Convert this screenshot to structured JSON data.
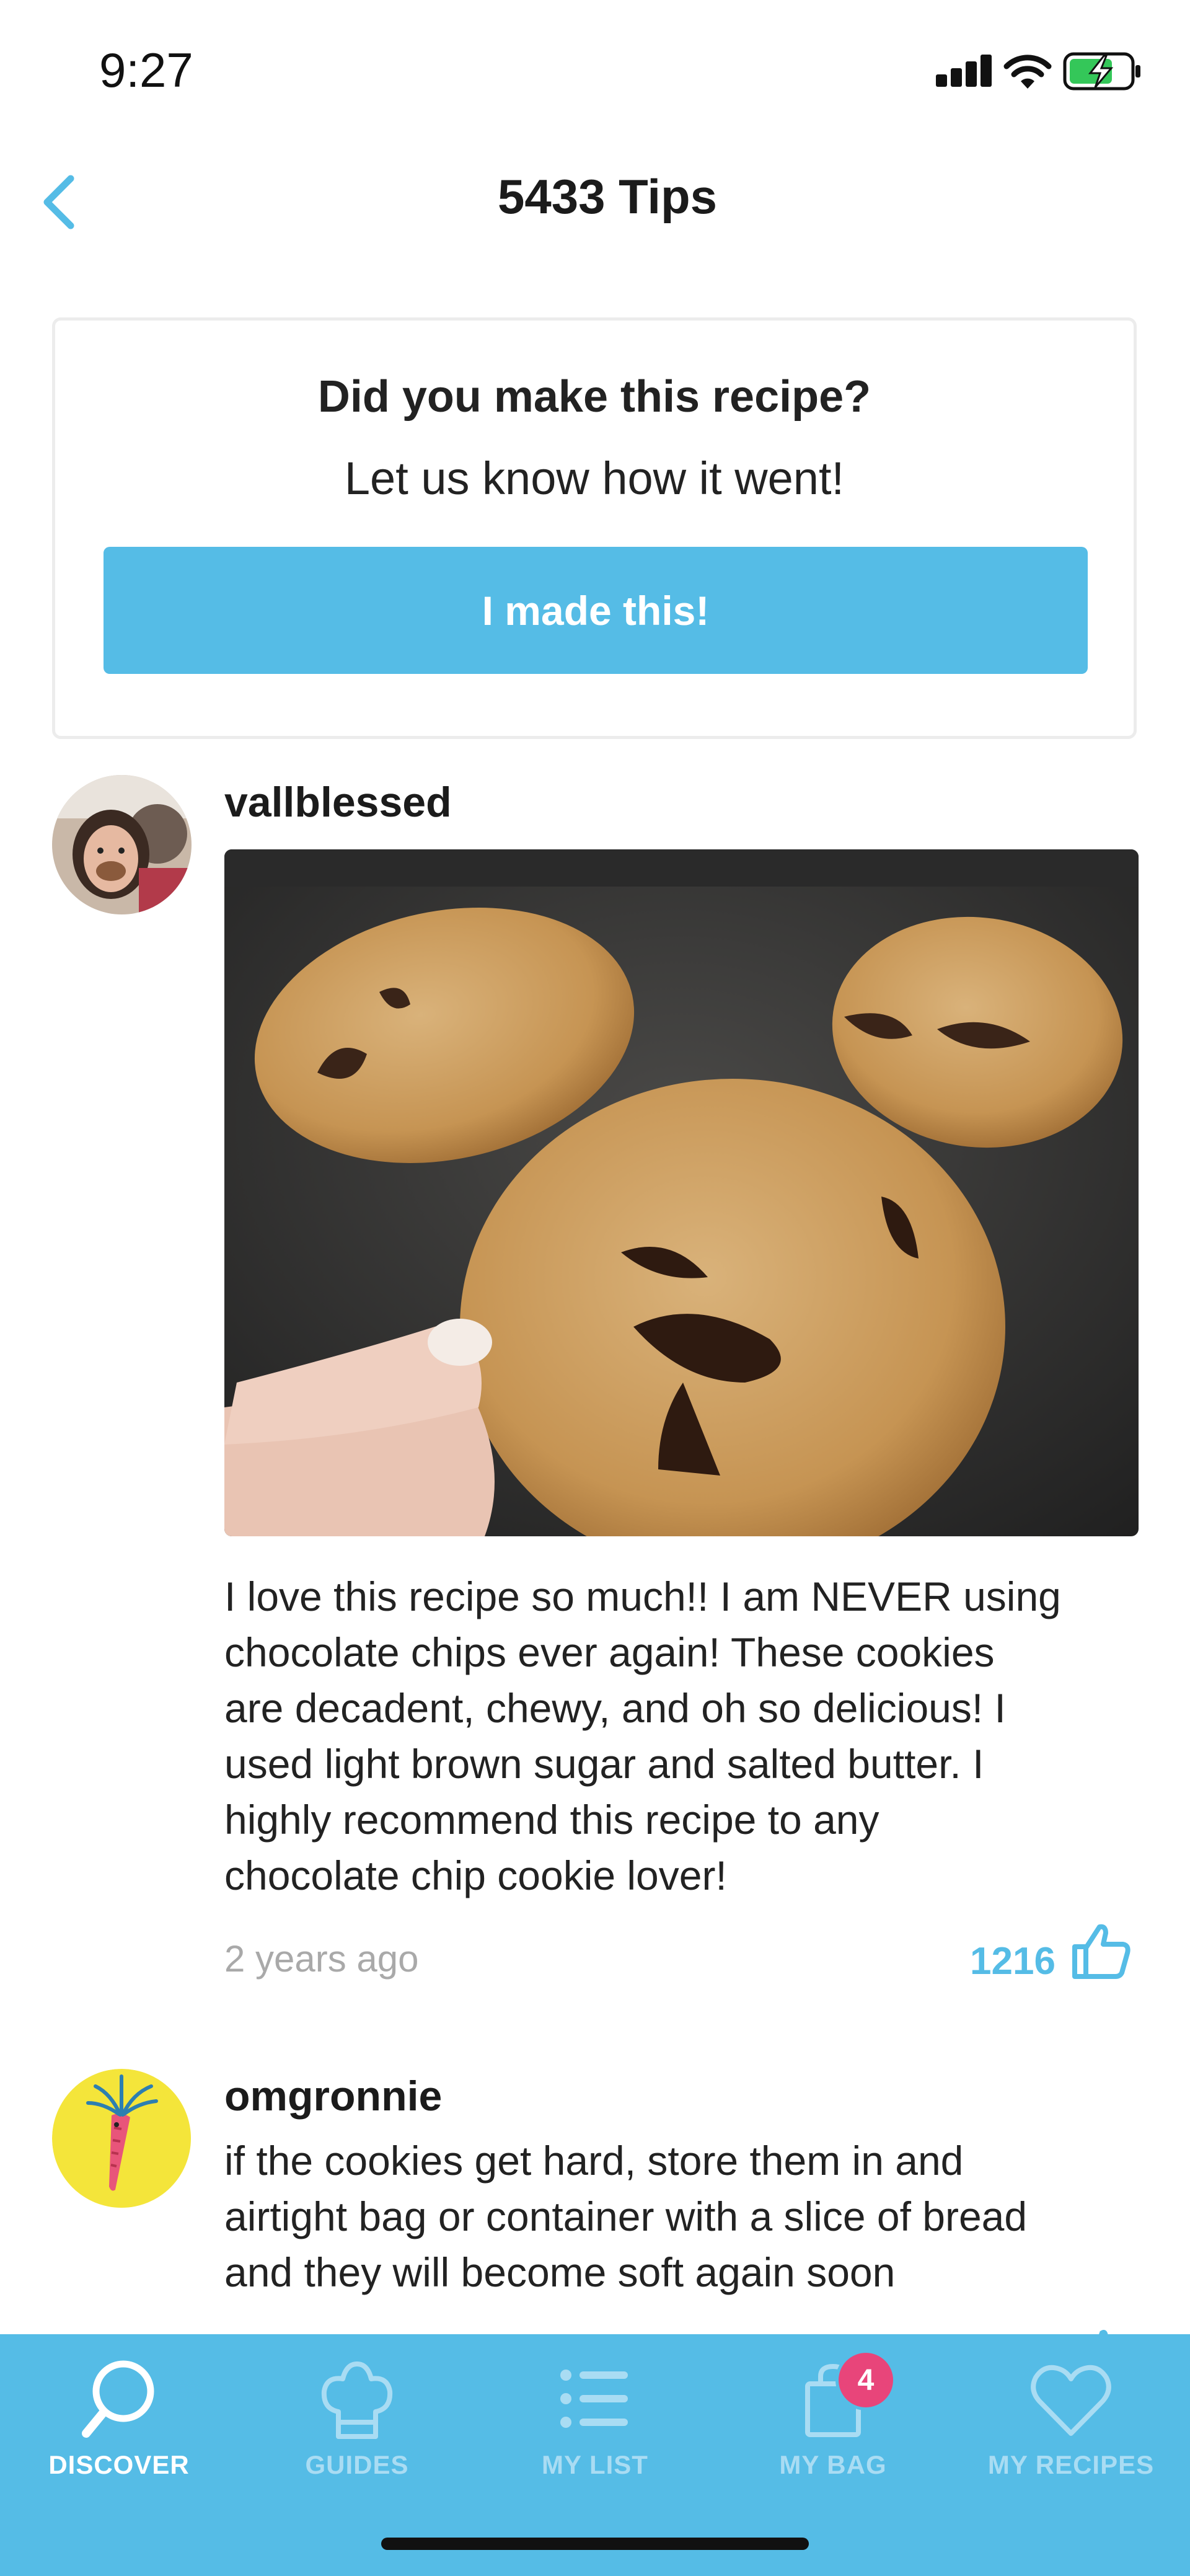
{
  "status_bar": {
    "time": "9:27"
  },
  "header": {
    "title": "5433 Tips"
  },
  "made_this_card": {
    "heading": "Did you make this recipe?",
    "subheading": "Let us know how it went!",
    "button_label": "I made this!"
  },
  "tips": [
    {
      "username": "vallblessed",
      "text": "I love this recipe so much!! I am NEVER using chocolate chips ever again! These cookies are decadent, chewy, and oh so delicious! I used light brown sugar and salted butter. I highly recommend this recipe to any chocolate chip cookie lover!",
      "text_lines": [
        "I love this recipe so much!! I am NEVER using",
        "chocolate chips ever again! These cookies",
        "are decadent, chewy, and oh so delicious! I",
        "used light brown sugar and salted butter. I",
        "highly recommend this recipe to any",
        "chocolate chip cookie lover!"
      ],
      "time_ago": "2 years ago",
      "likes": "1216"
    },
    {
      "username": "omgronnie",
      "text": "if the cookies get hard, store them in and airtight bag or container with a slice of bread and they will become soft again soon",
      "text_lines": [
        "if the cookies get hard, store them in and",
        "airtight bag or container with a slice of bread",
        "and they will become soft again soon"
      ]
    }
  ],
  "tab_bar": {
    "tabs": [
      {
        "label": "DISCOVER",
        "icon": "search-icon",
        "active": true
      },
      {
        "label": "GUIDES",
        "icon": "chef-hat-icon",
        "active": false
      },
      {
        "label": "MY LIST",
        "icon": "list-icon",
        "active": false
      },
      {
        "label": "MY BAG",
        "icon": "bag-icon",
        "active": false,
        "badge": "4"
      },
      {
        "label": "MY RECIPES",
        "icon": "heart-icon",
        "active": false
      }
    ]
  },
  "colors": {
    "accent": "#55bce6",
    "badge": "#e8457a",
    "inactive_tab": "#a9dcf3"
  }
}
